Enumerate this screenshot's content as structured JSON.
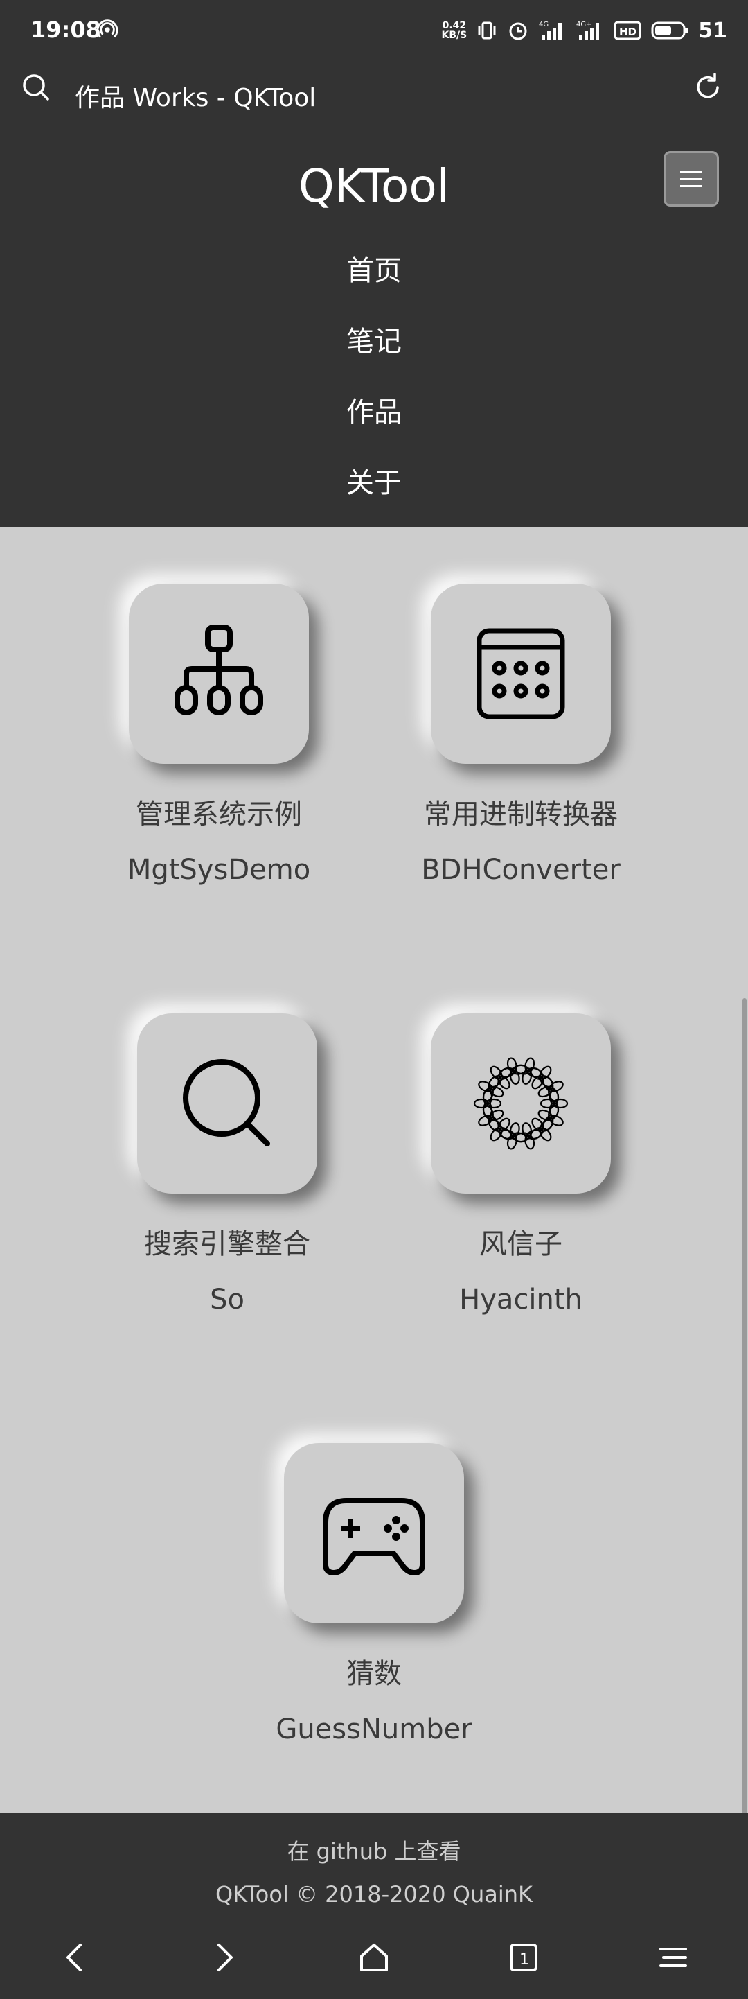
{
  "status": {
    "time": "19:08",
    "net_speed_value": "0.42",
    "net_speed_unit": "KB/S",
    "battery": "51"
  },
  "browser": {
    "tab_title": "作品 Works - QKTool"
  },
  "site": {
    "brand": "QKTool",
    "nav": [
      "首页",
      "笔记",
      "作品",
      "关于"
    ]
  },
  "works": [
    {
      "cn": "管理系统示例",
      "en": "MgtSysDemo",
      "icon": "sitemap-icon"
    },
    {
      "cn": "常用进制转换器",
      "en": "BDHConverter",
      "icon": "calculator-icon"
    },
    {
      "cn": "搜索引擎整合",
      "en": "So",
      "icon": "search-icon"
    },
    {
      "cn": "风信子",
      "en": "Hyacinth",
      "icon": "flower-icon"
    },
    {
      "cn": "猜数",
      "en": "GuessNumber",
      "icon": "gamepad-icon"
    }
  ],
  "footer": {
    "github": "在 github 上查看",
    "copyright": "QKTool © 2018-2020 QuainK"
  },
  "colors": {
    "header_bg": "#333333",
    "page_bg": "#cdcdcd"
  }
}
